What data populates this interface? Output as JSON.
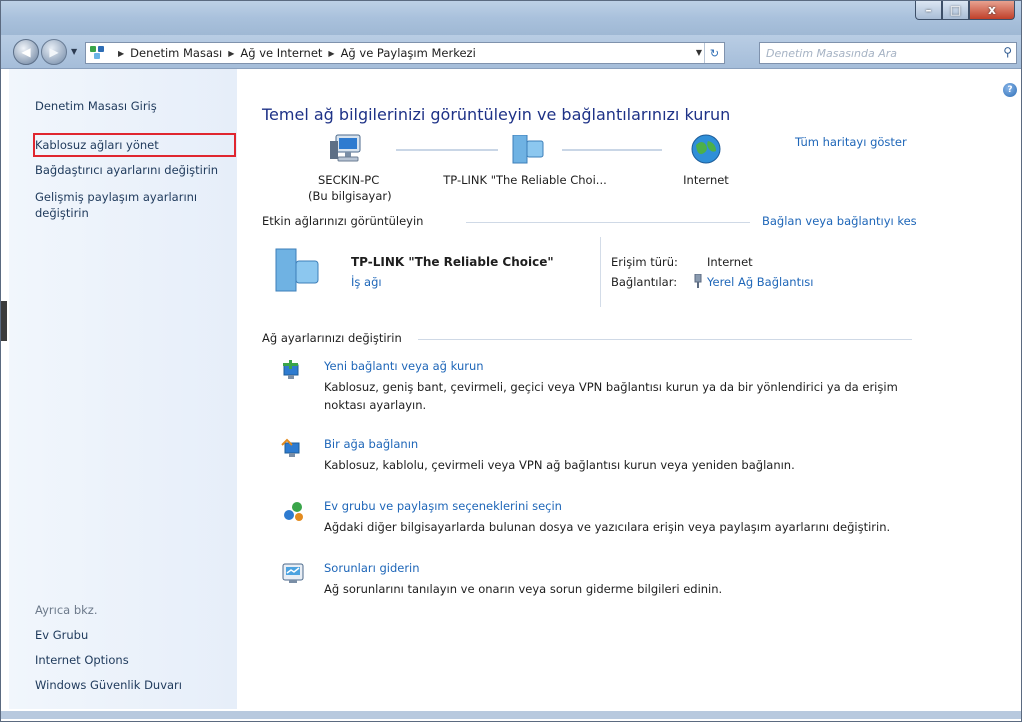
{
  "window": {
    "caption_buttons": {
      "minimize": "–",
      "maximize": "□",
      "close": "x"
    }
  },
  "address_bar": {
    "crumbs": [
      "Denetim Masası",
      "Ağ ve Internet",
      "Ağ ve Paylaşım Merkezi"
    ],
    "search_placeholder": "Denetim Masasında Ara"
  },
  "sidebar": {
    "home_link": "Denetim Masası Giriş",
    "links": [
      "Kablosuz ağları yönet",
      "Bağdaştırıcı ayarlarını değiştirin",
      "Gelişmiş paylaşım ayarlarını",
      "değiştirin"
    ],
    "see_also_label": "Ayrıca bkz.",
    "see_also": [
      "Ev Grubu",
      "Internet Options",
      "Windows Güvenlik Duvarı"
    ]
  },
  "main": {
    "title": "Temel ağ bilgilerinizi görüntüleyin ve bağlantılarınızı kurun",
    "full_map_link": "Tüm haritayı göster",
    "map_nodes": [
      {
        "label": "SECKIN-PC",
        "sublabel": "(Bu bilgisayar)"
      },
      {
        "label": "TP-LINK \"The Reliable Choi..."
      },
      {
        "label": "Internet"
      }
    ],
    "active_networks_heading": "Etkin ağlarınızı görüntüleyin",
    "connect_disconnect_link": "Bağlan veya bağlantıyı kes",
    "network": {
      "name": "TP-LINK \"The Reliable Choice\"",
      "type_link": "İş ağı",
      "access_type_label": "Erişim türü:",
      "access_type_value": "Internet",
      "connections_label": "Bağlantılar:",
      "connections_value": "Yerel Ağ Bağlantısı"
    },
    "change_settings_heading": "Ağ ayarlarınızı değiştirin",
    "tasks": [
      {
        "link": "Yeni bağlantı veya ağ kurun",
        "desc": "Kablosuz, geniş bant, çevirmeli, geçici veya VPN bağlantısı kurun ya da bir yönlendirici ya da erişim",
        "desc2": "noktası ayarlayın."
      },
      {
        "link": "Bir ağa bağlanın",
        "desc": "Kablosuz, kablolu, çevirmeli veya VPN ağ bağlantısı kurun veya yeniden bağlanın."
      },
      {
        "link": "Ev grubu ve paylaşım seçeneklerini seçin",
        "desc": "Ağdaki diğer bilgisayarlarda bulunan dosya ve yazıcılara erişin veya paylaşım ayarlarını değiştirin."
      },
      {
        "link": "Sorunları giderin",
        "desc": "Ağ sorunlarını tanılayın ve onarın veya sorun giderme bilgileri edinin."
      }
    ]
  },
  "colors": {
    "link": "#1e66b8",
    "title": "#1e3287",
    "highlight_box": "#e0262f"
  }
}
